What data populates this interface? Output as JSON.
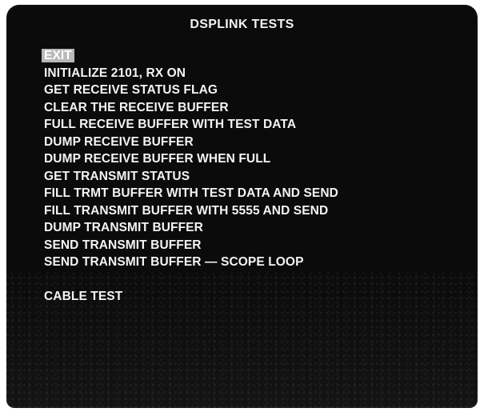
{
  "screen": {
    "title": "DSPLINK TESTS"
  },
  "menu": {
    "selected_index": 0,
    "items": [
      "EXIT",
      "INITIALIZE 2101,  RX ON",
      "GET RECEIVE STATUS FLAG",
      "CLEAR THE RECEIVE BUFFER",
      "FULL RECEIVE BUFFER WITH TEST DATA",
      "DUMP RECEIVE BUFFER",
      "DUMP RECEIVE BUFFER WHEN FULL",
      "GET TRANSMIT STATUS",
      "FILL TRMT BUFFER WITH TEST DATA AND SEND",
      "FILL TRANSMIT BUFFER WITH 5555 AND SEND",
      "DUMP TRANSMIT BUFFER",
      "SEND TRANSMIT BUFFER",
      "SEND TRANSMIT BUFFER — SCOPE LOOP",
      "CABLE TEST"
    ]
  },
  "colors": {
    "background": "#0b0b0b",
    "text": "#f4f4f4",
    "highlight": "#b9b9b9"
  }
}
